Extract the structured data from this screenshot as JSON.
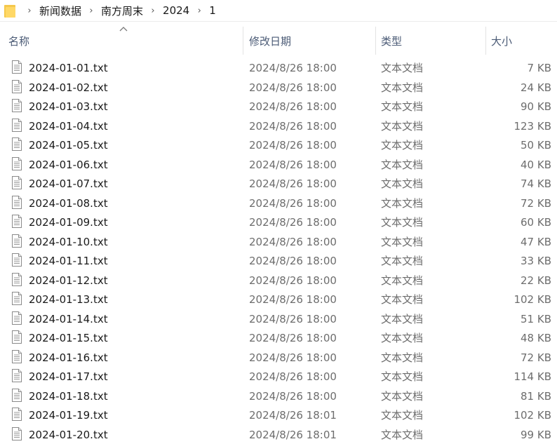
{
  "breadcrumb": {
    "icon": "folder-icon",
    "items": [
      "新闻数据",
      "南方周末",
      "2024",
      "1"
    ]
  },
  "columns": {
    "name": "名称",
    "date": "修改日期",
    "type": "类型",
    "size": "大小"
  },
  "files": [
    {
      "name": "2024-01-01.txt",
      "date": "2024/8/26 18:00",
      "type": "文本文档",
      "size": "7 KB"
    },
    {
      "name": "2024-01-02.txt",
      "date": "2024/8/26 18:00",
      "type": "文本文档",
      "size": "24 KB"
    },
    {
      "name": "2024-01-03.txt",
      "date": "2024/8/26 18:00",
      "type": "文本文档",
      "size": "90 KB"
    },
    {
      "name": "2024-01-04.txt",
      "date": "2024/8/26 18:00",
      "type": "文本文档",
      "size": "123 KB"
    },
    {
      "name": "2024-01-05.txt",
      "date": "2024/8/26 18:00",
      "type": "文本文档",
      "size": "50 KB"
    },
    {
      "name": "2024-01-06.txt",
      "date": "2024/8/26 18:00",
      "type": "文本文档",
      "size": "40 KB"
    },
    {
      "name": "2024-01-07.txt",
      "date": "2024/8/26 18:00",
      "type": "文本文档",
      "size": "74 KB"
    },
    {
      "name": "2024-01-08.txt",
      "date": "2024/8/26 18:00",
      "type": "文本文档",
      "size": "72 KB"
    },
    {
      "name": "2024-01-09.txt",
      "date": "2024/8/26 18:00",
      "type": "文本文档",
      "size": "60 KB"
    },
    {
      "name": "2024-01-10.txt",
      "date": "2024/8/26 18:00",
      "type": "文本文档",
      "size": "47 KB"
    },
    {
      "name": "2024-01-11.txt",
      "date": "2024/8/26 18:00",
      "type": "文本文档",
      "size": "33 KB"
    },
    {
      "name": "2024-01-12.txt",
      "date": "2024/8/26 18:00",
      "type": "文本文档",
      "size": "22 KB"
    },
    {
      "name": "2024-01-13.txt",
      "date": "2024/8/26 18:00",
      "type": "文本文档",
      "size": "102 KB"
    },
    {
      "name": "2024-01-14.txt",
      "date": "2024/8/26 18:00",
      "type": "文本文档",
      "size": "51 KB"
    },
    {
      "name": "2024-01-15.txt",
      "date": "2024/8/26 18:00",
      "type": "文本文档",
      "size": "48 KB"
    },
    {
      "name": "2024-01-16.txt",
      "date": "2024/8/26 18:00",
      "type": "文本文档",
      "size": "72 KB"
    },
    {
      "name": "2024-01-17.txt",
      "date": "2024/8/26 18:00",
      "type": "文本文档",
      "size": "114 KB"
    },
    {
      "name": "2024-01-18.txt",
      "date": "2024/8/26 18:00",
      "type": "文本文档",
      "size": "81 KB"
    },
    {
      "name": "2024-01-19.txt",
      "date": "2024/8/26 18:01",
      "type": "文本文档",
      "size": "102 KB"
    },
    {
      "name": "2024-01-20.txt",
      "date": "2024/8/26 18:01",
      "type": "文本文档",
      "size": "99 KB"
    }
  ],
  "file_icon": "text-file-icon",
  "sort_indicator": "sort-ascending-icon"
}
